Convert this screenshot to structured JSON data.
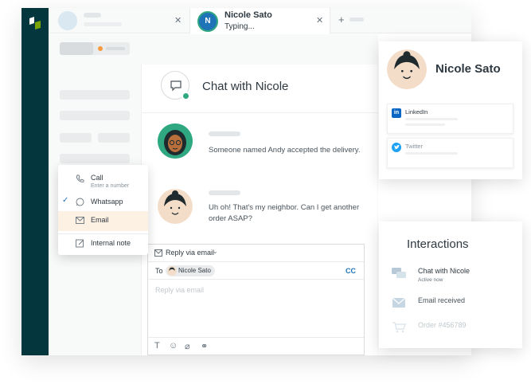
{
  "colors": {
    "rail": "#03363d",
    "brand_green": "#2fa882",
    "accent_blue": "#1f73b7",
    "menu_highlight": "#fdf1e4",
    "badge_orange": "#f79a3e"
  },
  "tabs": [
    {
      "label": "",
      "close_icon": "close-icon"
    },
    {
      "avatar_initial": "N",
      "name": "Nicole Sato",
      "status": "Typing...",
      "close_icon": "close-icon"
    }
  ],
  "tabbar": {
    "add_icon": "plus-icon"
  },
  "conversation": {
    "title": "Chat with Nicole",
    "messages": [
      {
        "text": "Someone named Andy accepted the delivery."
      },
      {
        "text": "Uh oh! That's my neighbor. Can I get another order ASAP?"
      }
    ]
  },
  "reply": {
    "channel_label": "Reply via email",
    "to_label": "To",
    "recipient": "Nicole Sato",
    "cc_label": "CC",
    "placeholder": "Reply via email",
    "tools": [
      "text-format-icon",
      "emoji-icon",
      "attachment-icon",
      "link-icon"
    ]
  },
  "channel_menu": {
    "items": [
      {
        "label": "Call",
        "sublabel": "Enter a number",
        "icon": "phone-icon",
        "checked": false,
        "highlighted": false
      },
      {
        "label": "Whatsapp",
        "icon": "whatsapp-icon",
        "checked": true,
        "highlighted": false
      },
      {
        "label": "Email",
        "icon": "email-icon",
        "checked": false,
        "highlighted": true
      },
      {
        "label": "Internal note",
        "icon": "note-icon",
        "checked": false,
        "highlighted": false
      }
    ]
  },
  "profile": {
    "name": "Nicole Sato",
    "socials": [
      {
        "label": "LinkedIn",
        "icon": "linkedin-icon",
        "color": "#0a66c2"
      },
      {
        "label": "Twitter",
        "icon": "twitter-icon",
        "color": "#1da1f2"
      }
    ]
  },
  "interactions": {
    "title": "Interactions",
    "items": [
      {
        "label": "Chat with Nicole",
        "sublabel": "Active now",
        "icon": "chat-icon"
      },
      {
        "label": "Email received",
        "icon": "email-icon"
      },
      {
        "label": "Order #456789",
        "icon": "cart-icon"
      }
    ]
  }
}
